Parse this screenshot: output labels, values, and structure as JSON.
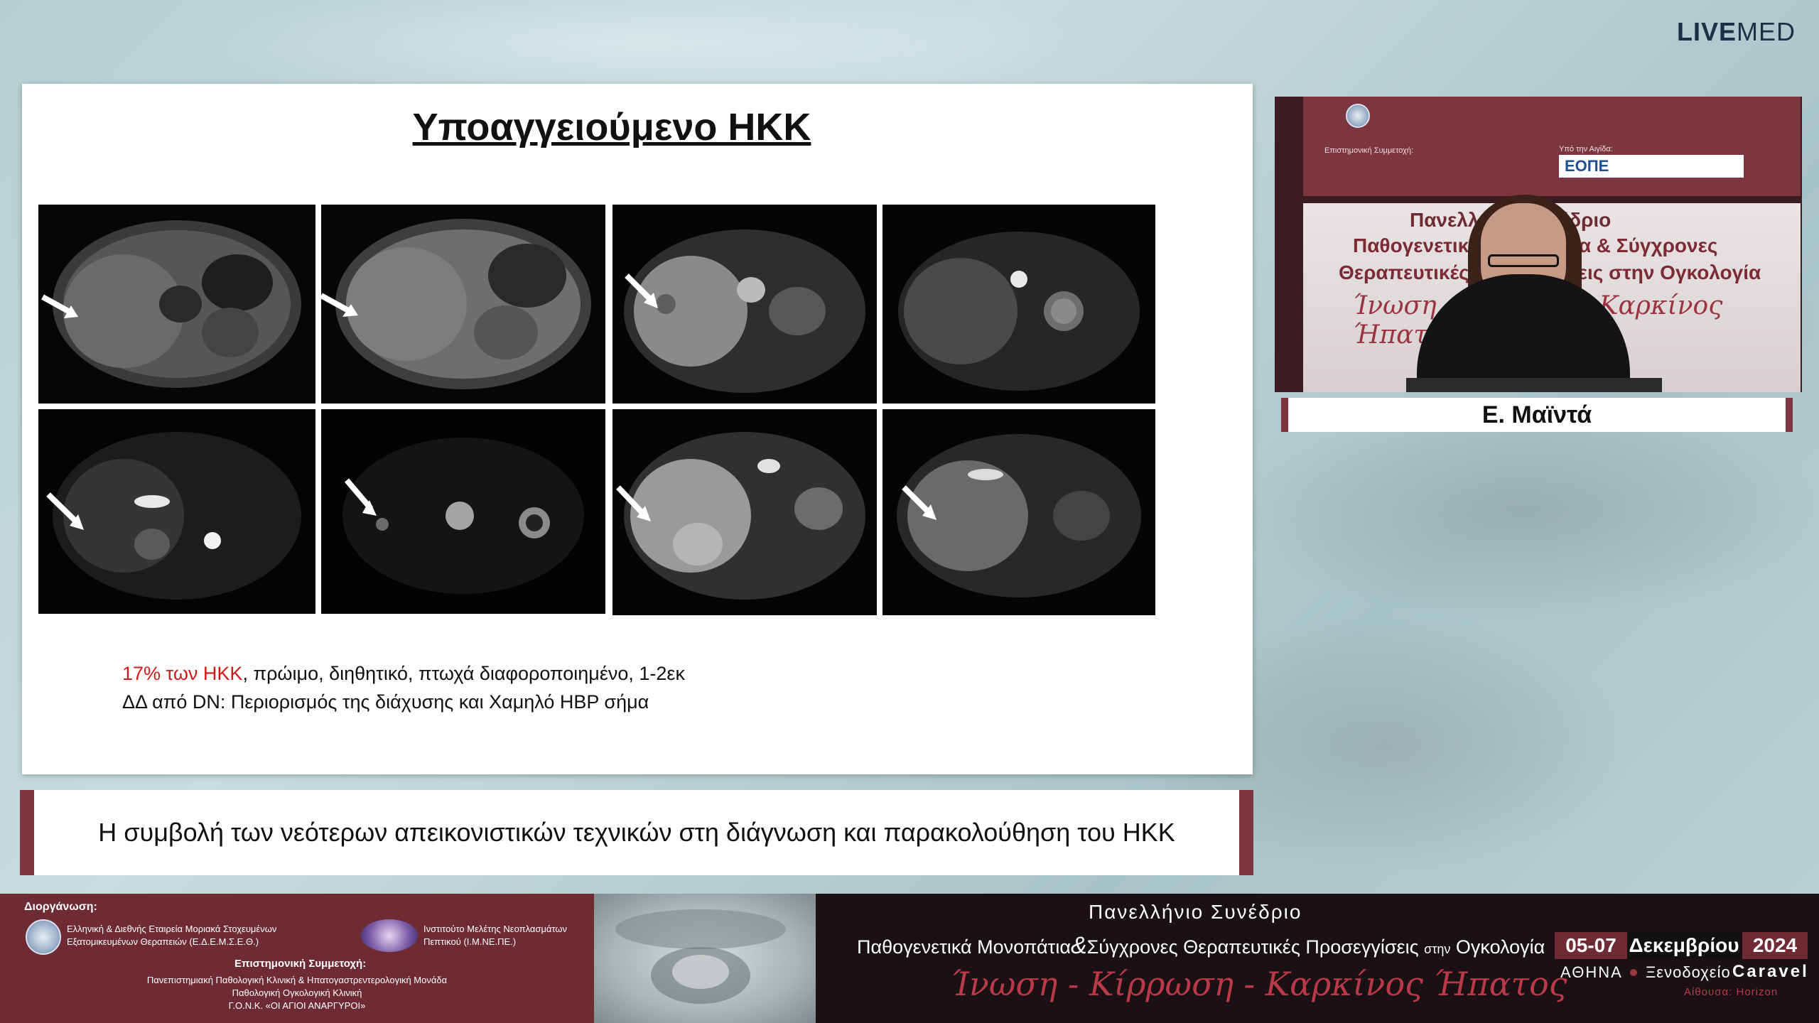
{
  "brand": {
    "bold": "LIVE",
    "light": "MED"
  },
  "slide": {
    "title": "Υποαγγειούμενο ΗΚΚ",
    "caption_highlight": "17% των ΗΚΚ",
    "caption_line1_rest": ", πρώιμο, διηθητικό, πτωχά διαφοροποιημένο, 1-2εκ",
    "caption_line2": "ΔΔ από DN: Περιορισμός της διάχυσης και Χαμηλό HBP σήμα"
  },
  "video": {
    "banner_title": "Πανελλήνιο Συνέδριο",
    "banner_line1": "Παθογενετικά Μονοπάτια & Σύγχρονες",
    "banner_line2": "Θεραπευτικές Προσεγγίσεις στην Ογκολογία",
    "banner_handwriting": "Ίνωση - Κίρρωση - Καρκίνος Ήπατος",
    "banner_small_org": "Επιστημονική Συμμετοχή:",
    "banner_small_support": "Υπό την Αιγίδα:",
    "banner_logo": "ΕΟΠΕ"
  },
  "speaker": {
    "name": "Ε. Μαϊντά"
  },
  "lecture": {
    "title": "Η συμβολή των νεότερων απεικονιστικών τεχνικών στη διάγνωση και παρακολούθηση του ΗΚΚ"
  },
  "footer": {
    "organizer_label": "Διοργάνωση:",
    "org1_line1": "Ελληνική & Διεθνής Εταιρεία Μοριακά Στοχευμένων",
    "org1_line2": "Εξατομικευμένων Θεραπειών (Ε.Δ.Ε.Μ.Σ.Ε.Θ.)",
    "org2_line1": "Ινστιτούτο Μελέτης Νεοπλασμάτων",
    "org2_line2": "Πεπτικού (Ι.Μ.ΝΕ.ΠΕ.)",
    "participation_label": "Επιστημονική Συμμετοχή:",
    "part_line1": "Πανεπιστημιακή Παθολογική Κλινική & Ηπατογαστρεντερολογική Μονάδα",
    "part_line2": "Παθολογική Ογκολογική Κλινική",
    "part_line3": "Γ.Ο.Ν.Κ. «ΟΙ ΑΓΙΟΙ ΑΝΑΡΓΥΡΟΙ»",
    "congress_title": "Πανελλήνιο Συνέδριο",
    "congress_subtitle_a": "Παθογενετικά Μονοπάτια",
    "congress_amp": "&",
    "congress_subtitle_b": "Σύγχρονες Θεραπευτικές Προσεγγίσεις",
    "congress_subtitle_small": "στην",
    "congress_subtitle_c": "Ογκολογία",
    "handwriting": "Ίνωση - Κίρρωση - Καρκίνος Ήπατος",
    "dates": "05-07",
    "month": "Δεκεμβρίου",
    "year": "2024",
    "city": "ΑΘΗΝΑ",
    "venue_label": "Ξενοδοχείο",
    "venue": "Caravel",
    "hall": "Αίθουσα: Horizon"
  },
  "colors": {
    "accent": "#7c3640",
    "highlight": "#d11a1a"
  }
}
